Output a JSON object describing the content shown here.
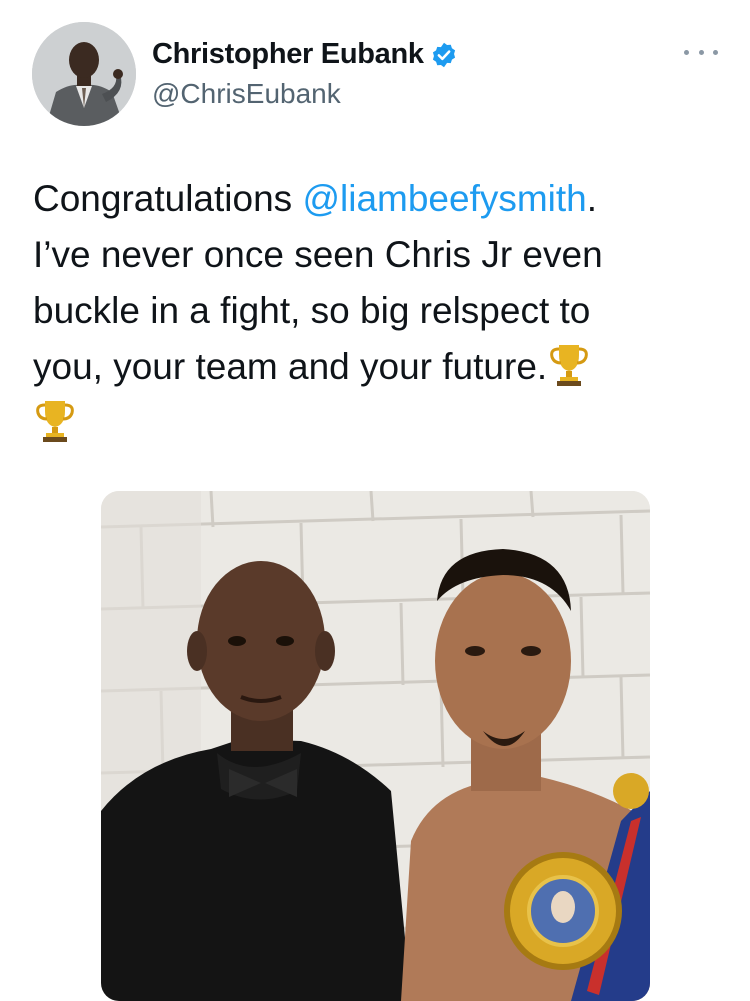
{
  "author": {
    "display_name": "Christopher Eubank",
    "handle": "@ChrisEubank",
    "verified": true,
    "verified_icon": "verified-badge-icon",
    "verified_color": "#1d9bf0"
  },
  "menu_icon": "more-options-icon",
  "tweet": {
    "line1_prefix": "Congratulations ",
    "mention": "@liambeefysmith",
    "line1_suffix": ".",
    "line2": "I’ve never once seen Chris Jr even",
    "line3": "buckle in a fight, so big relspect to",
    "line4": "you, your team and your future.",
    "trophy_emoji": "trophy-icon"
  },
  "colors": {
    "text": "#0f1419",
    "secondary_text": "#536471",
    "mention": "#1d9bf0"
  },
  "media": {
    "type": "photo"
  }
}
